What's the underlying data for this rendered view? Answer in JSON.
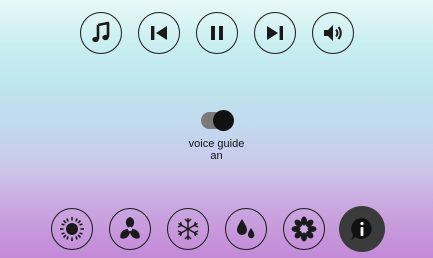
{
  "media_controls": {
    "icons": [
      "music-note-icon",
      "skip-previous-icon",
      "pause-icon",
      "skip-next-icon",
      "volume-icon"
    ]
  },
  "voice_guide": {
    "label": "voice guide",
    "state": "an",
    "enabled": true
  },
  "mode_bar": {
    "icons": [
      "sun-icon",
      "fan-icon",
      "snowflake-icon",
      "water-drops-icon",
      "flower-icon",
      "info-icon"
    ],
    "active": "info-icon"
  },
  "colors": {
    "icon": "#1a1a1a",
    "active_button": "#3b3b3b",
    "toggle_track": "#7a7a7a"
  }
}
